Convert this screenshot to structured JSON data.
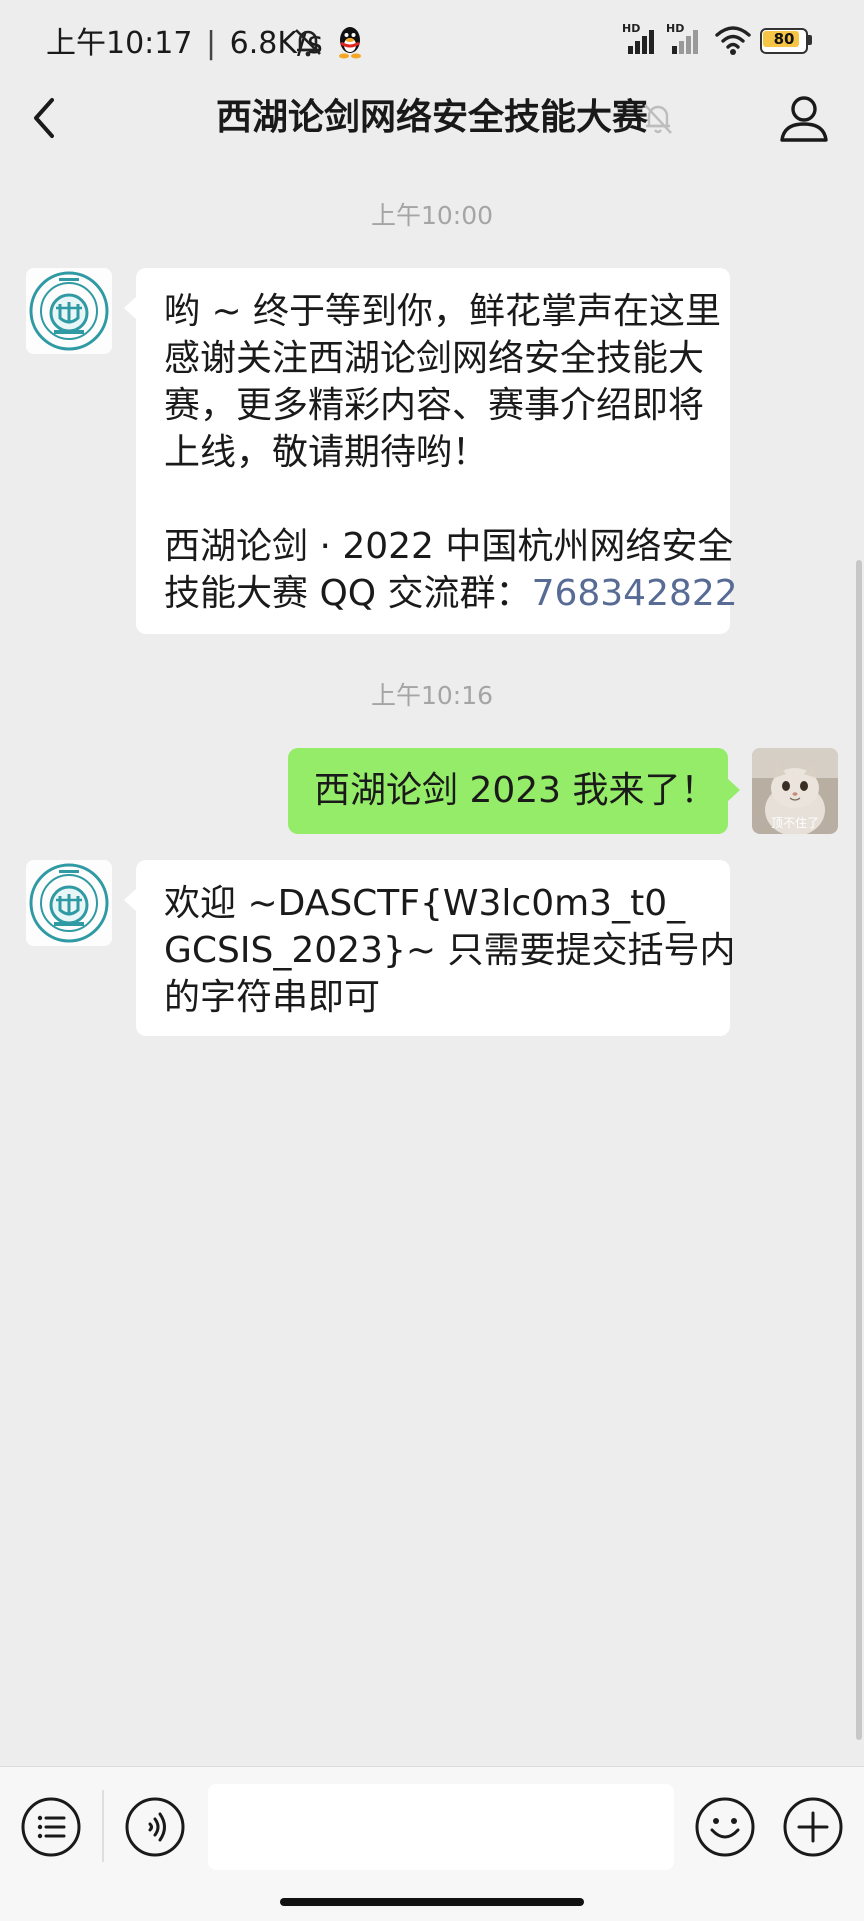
{
  "status_bar": {
    "time": "上午10:17",
    "separator": "|",
    "net_speed": "6.8K/s",
    "signal_1_label": "HD",
    "signal_2_label": "HD",
    "battery": "80",
    "icons": [
      "alarm-off-icon",
      "qq-penguin-icon",
      "signal-icon",
      "wifi-icon",
      "battery-icon"
    ]
  },
  "header": {
    "title": "西湖论剑网络安全技能大赛",
    "back_icon": "chevron-left-icon",
    "mute_icon": "bell-muted-icon",
    "profile_icon": "person-icon"
  },
  "messages": {
    "timestamp_1": "上午10:00",
    "msg_1_lines": [
      "哟 ~ 终于等到你，鲜花掌声在这里",
      "感谢关注西湖论剑网络安全技能大",
      "赛，更多精彩内容、赛事介绍即将",
      "上线，敬请期待哟！"
    ],
    "msg_1_lines2": [
      "西湖论剑 · 2022 中国杭州网络安全"
    ],
    "msg_1_line_last_prefix": "技能大赛 QQ 交流群：",
    "msg_1_link": "768342822",
    "timestamp_2": "上午10:16",
    "msg_2": "西湖论剑 2023 我来了！",
    "msg_2_sticker_text": "顶不住了",
    "msg_3_lines": [
      "欢迎 ~DASCTF{W3lc0m3_t0_",
      "GCSIS_2023}~ 只需要提交括号内",
      "的字符串即可"
    ]
  },
  "input_bar": {
    "menu_icon": "list-menu-icon",
    "voice_icon": "voice-icon",
    "emoji_icon": "smile-icon",
    "plus_icon": "plus-icon",
    "input_value": ""
  },
  "colors": {
    "background": "#ededed",
    "incoming_bubble": "#ffffff",
    "outgoing_bubble": "#95ec69",
    "link": "#576b95",
    "logo_teal": "#2f9aa3"
  }
}
